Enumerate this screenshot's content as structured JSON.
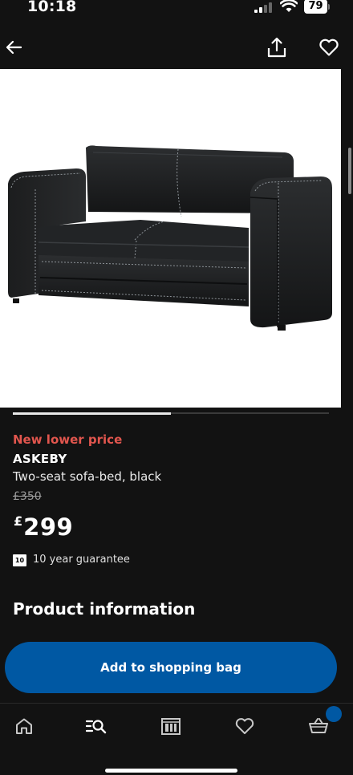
{
  "status_bar": {
    "time": "10:18",
    "battery": "79"
  },
  "nav": {
    "back_icon": "arrow-left-icon",
    "share_icon": "share-icon",
    "favorite_icon": "heart-icon"
  },
  "carousel": {
    "progress": 0.5
  },
  "product": {
    "badge": "New lower price",
    "name": "ASKEBY",
    "description": "Two-seat sofa-bed, black",
    "old_price": "£350",
    "currency": "£",
    "price": "299",
    "guarantee_years": "10",
    "guarantee_text": "10 year guarantee"
  },
  "sections": {
    "product_information": "Product information"
  },
  "actions": {
    "add_to_bag": "Add to shopping bag"
  },
  "tabbar": {
    "items": [
      {
        "name": "home",
        "icon": "home-icon"
      },
      {
        "name": "search",
        "icon": "search-list-icon"
      },
      {
        "name": "rooms",
        "icon": "rooms-icon"
      },
      {
        "name": "favourites",
        "icon": "heart-icon"
      },
      {
        "name": "shopping-bag",
        "icon": "basket-icon"
      }
    ]
  },
  "colors": {
    "background": "#121212",
    "badge_red": "#e2564e",
    "accent_blue": "#0058a3"
  }
}
